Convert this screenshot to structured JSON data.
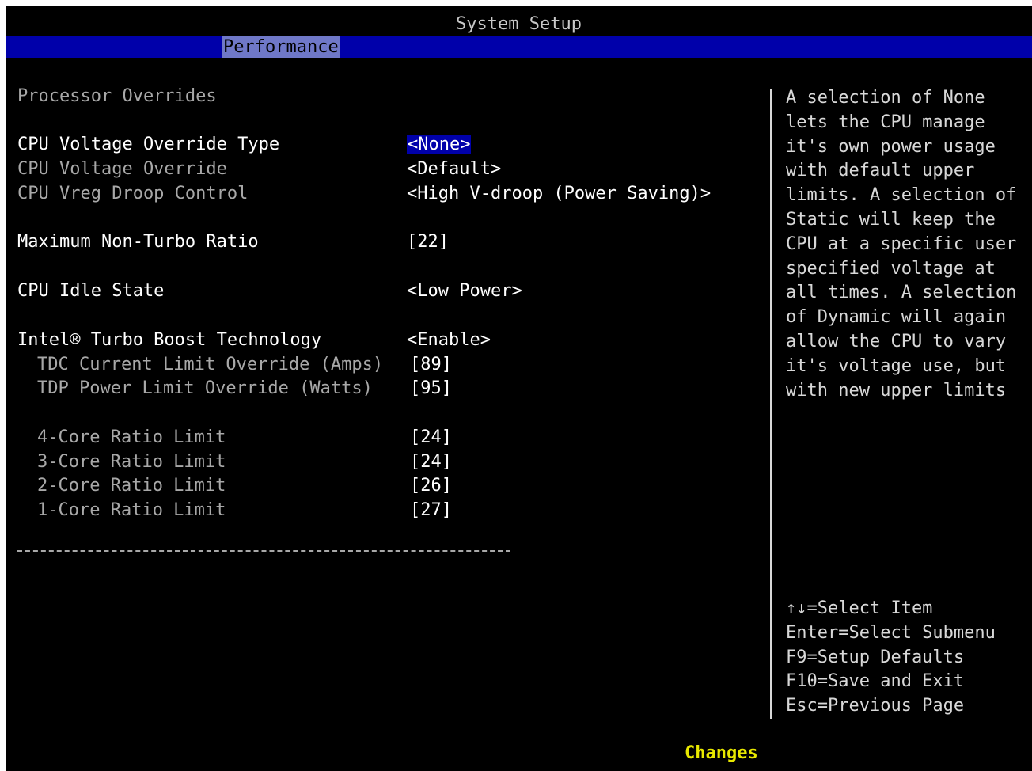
{
  "header": {
    "title": "System Setup",
    "active_tab": "Performance"
  },
  "section": {
    "title": "Processor Overrides"
  },
  "settings": [
    {
      "label": "CPU Voltage Override Type",
      "value": "<None>"
    },
    {
      "label": "CPU Voltage Override",
      "value": "<Default>"
    },
    {
      "label": "CPU Vreg Droop Control",
      "value": "<High V-droop (Power Saving)>"
    },
    {
      "label": "Maximum Non-Turbo Ratio",
      "value": "[22]"
    },
    {
      "label": "CPU Idle State",
      "value": "<Low Power>"
    },
    {
      "label": "Intel® Turbo Boost Technology",
      "value": "<Enable>"
    },
    {
      "label": "TDC Current Limit Override (Amps)",
      "value": "[89]"
    },
    {
      "label": "TDP Power Limit Override (Watts)",
      "value": "[95]"
    },
    {
      "label": "4-Core Ratio Limit",
      "value": "[24]"
    },
    {
      "label": "3-Core Ratio Limit",
      "value": "[24]"
    },
    {
      "label": "2-Core Ratio Limit",
      "value": "[26]"
    },
    {
      "label": "1-Core Ratio Limit",
      "value": "[27]"
    }
  ],
  "help_text": "A selection of None lets the CPU manage it's own power usage with default upper limits. A selection of Static will keep the CPU at a specific user specified voltage at all times. A selection of Dynamic will again allow the CPU to vary it's voltage use, but with new upper limits",
  "keys": [
    "↑↓=Select Item",
    "Enter=Select Submenu",
    "F9=Setup Defaults",
    "F10=Save and Exit",
    "Esc=Previous Page"
  ],
  "footer": {
    "status": "Changes"
  },
  "colors": {
    "background": "#000000",
    "tab_bar": "#0000aa",
    "active_tab": "#6f78c8",
    "footer_status": "#e8e800"
  }
}
